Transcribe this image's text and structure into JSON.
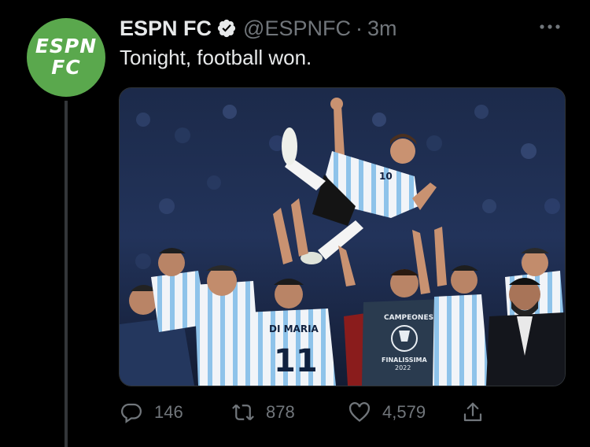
{
  "author": {
    "display_name": "ESPN FC",
    "handle": "@ESPNFC",
    "separator": "·",
    "time": "3m",
    "verified": true,
    "avatar": {
      "line1": "ESPN",
      "line2": "FC",
      "color": "#5aa84d"
    }
  },
  "tweet": {
    "text": "Tonight, football won."
  },
  "media": {
    "shirt_name": "DI MARIA",
    "shirt_number": "11",
    "hoisted_number": "10",
    "tshirt_top": "CAMPEONES",
    "tshirt_bottom": "FINALISSIMA",
    "tshirt_year": "2022"
  },
  "actions": {
    "replies": "146",
    "retweets": "878",
    "likes": "4,579"
  },
  "colors": {
    "background": "#000000",
    "text": "#e7e9ea",
    "muted": "#71767b",
    "accent": "#5aa84d"
  }
}
